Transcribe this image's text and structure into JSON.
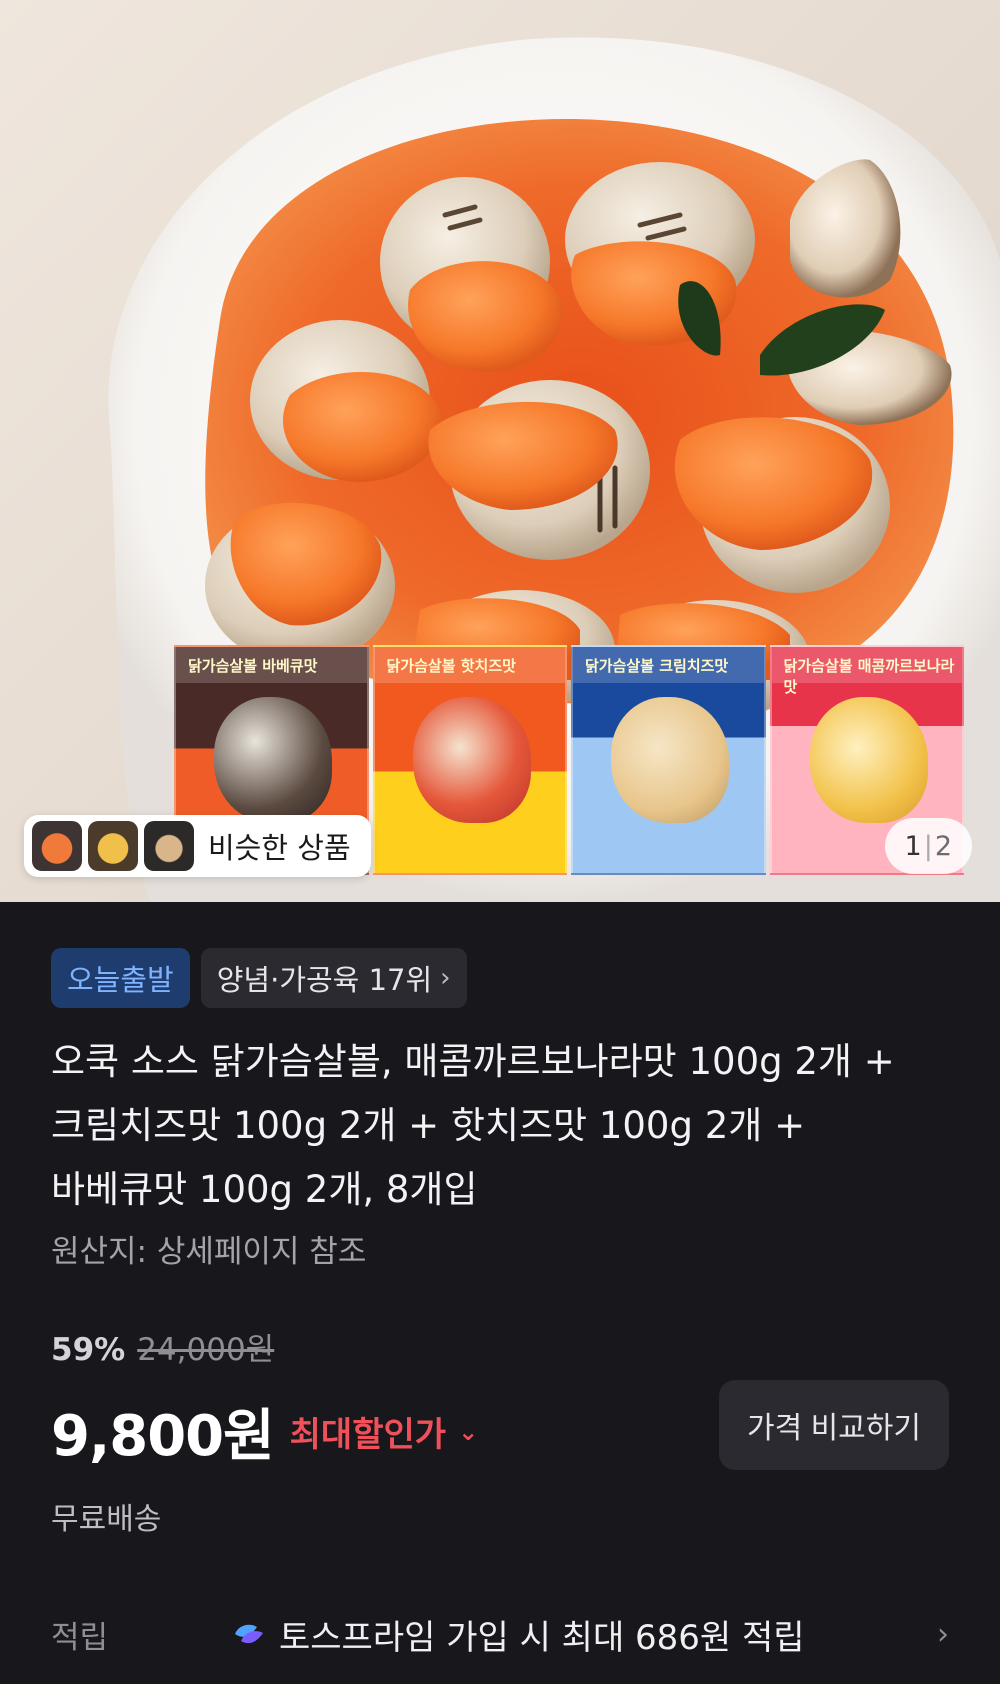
{
  "hero": {
    "similar_label": "비슷한 상품",
    "page_current": "1",
    "page_total": "2",
    "packs": [
      {
        "title": "닭가슴살볼 바베큐맛"
      },
      {
        "title": "닭가슴살볼 핫치즈맛"
      },
      {
        "title": "닭가슴살볼 크림치즈맛"
      },
      {
        "title": "닭가슴살볼 매콤까르보나라맛"
      }
    ]
  },
  "tags": {
    "today": "오늘출발",
    "rank": "양념·가공육 17위",
    "rank_chevron": "›"
  },
  "product": {
    "title": "오쿡 소스 닭가슴살볼, 매콤까르보나라맛 100g 2개 +\n크림치즈맛 100g 2개 + 핫치즈맛 100g 2개 +\n바베큐맛 100g 2개, 8개입",
    "origin": "원산지: 상세페이지 참조"
  },
  "price": {
    "discount_pct": "59%",
    "original": "24,000원",
    "current": "9,800원",
    "max_discount_label": "최대할인가",
    "max_discount_chevron": "⌄",
    "compare_button": "가격 비교하기",
    "shipping": "무료배송"
  },
  "reward": {
    "label": "적립",
    "text": "토스프라임 가입 시 최대 686원 적립",
    "arrow": "›",
    "icon_colors": [
      "#7a5cff",
      "#4fa3ff"
    ]
  },
  "colors": {
    "background": "#17171c",
    "accent_red": "#f0505a",
    "tag_today_bg": "#1f3c6e",
    "tag_today_text": "#7fb3ff"
  }
}
